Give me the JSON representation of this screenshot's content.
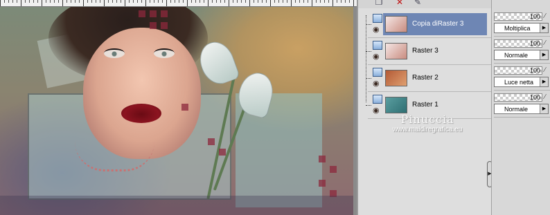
{
  "layers": [
    {
      "name": "Copia diRaster 3",
      "selected": true,
      "opacity": "100",
      "blend_mode": "Moltiplica",
      "thumb_colors": [
        "#f4e6e4",
        "#c98c80"
      ]
    },
    {
      "name": "Raster 3",
      "selected": false,
      "opacity": "100",
      "blend_mode": "Normale",
      "thumb_colors": [
        "#f4e6e4",
        "#c98c80"
      ]
    },
    {
      "name": "Raster 2",
      "selected": false,
      "opacity": "100",
      "blend_mode": "Luce netta",
      "thumb_colors": [
        "#b35a36",
        "#e0a070"
      ]
    },
    {
      "name": "Raster 1",
      "selected": false,
      "opacity": "100",
      "blend_mode": "Normale",
      "thumb_colors": [
        "#5a9ea0",
        "#2e6e72"
      ]
    }
  ],
  "watermark": {
    "name": "Pinuccia",
    "site": "www.maidiregrafica.eu"
  },
  "icons": {
    "toolbar": [
      "new-layer-icon",
      "delete-layer-icon",
      "edit-icon"
    ],
    "visibility": "eye-icon",
    "layer_type": "raster-layer-icon",
    "lock": "lock-icon",
    "dropdown": "chevron-right-icon"
  },
  "colors": {
    "selection": "#6e86b4",
    "panel_bg": "#dedede"
  }
}
